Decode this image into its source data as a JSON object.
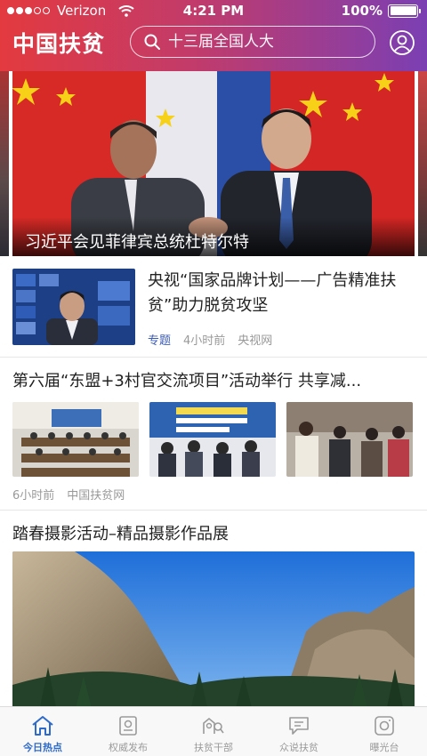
{
  "status_bar": {
    "carrier": "Verizon",
    "time": "4:21 PM",
    "battery": "100%",
    "battery_level": 1.0
  },
  "header": {
    "logo": "中国扶贫",
    "search_placeholder": "十三届全国人大"
  },
  "hero": {
    "caption": "习近平会见菲律宾总统杜特尔特"
  },
  "articles": [
    {
      "title": "央视“国家品牌计划——广告精准扶贫”助力脱贫攻坚",
      "tag": "专题",
      "time": "4小时前",
      "source": "央视网"
    },
    {
      "title": "第六届“东盟+3村官交流项目”活动举行 共享减...",
      "time": "6小时前",
      "source": "中国扶贫网"
    },
    {
      "title": "踏春摄影活动–精品摄影作品展"
    }
  ],
  "tabbar": {
    "items": [
      {
        "label": "今日热点",
        "icon": "home-icon",
        "active": true
      },
      {
        "label": "权威发布",
        "icon": "document-badge-icon",
        "active": false
      },
      {
        "label": "扶贫干部",
        "icon": "people-search-icon",
        "active": false
      },
      {
        "label": "众说扶贫",
        "icon": "chat-icon",
        "active": false
      },
      {
        "label": "曝光台",
        "icon": "camera-icon",
        "active": false
      }
    ]
  },
  "colors": {
    "header_gradient_start": "#e33a3f",
    "header_gradient_end": "#7b3fb3",
    "accent_blue": "#2e6ac9",
    "tag_blue": "#3c5bb5",
    "meta_gray": "#999999"
  }
}
